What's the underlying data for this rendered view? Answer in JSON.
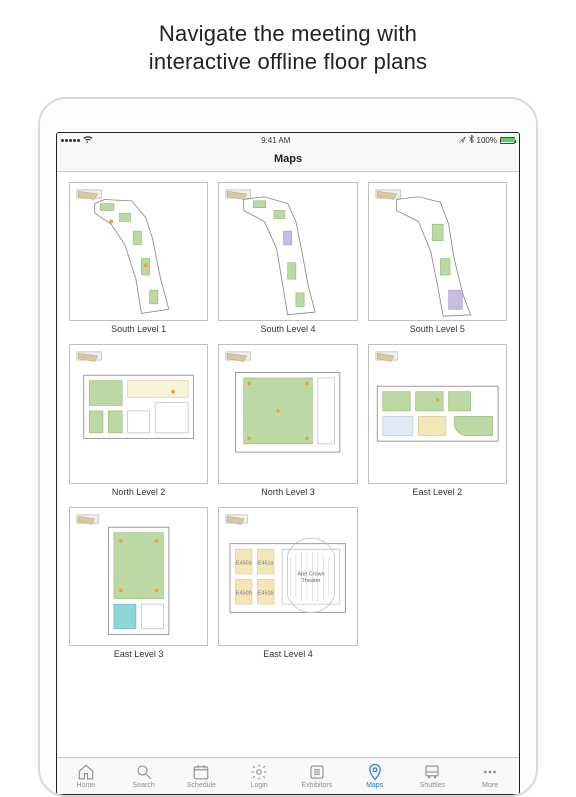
{
  "headline": {
    "line1": "Navigate the meeting with",
    "line2": "interactive offline floor plans"
  },
  "status": {
    "carrier_signal": "•••••",
    "wifi": "wifi",
    "time": "9:41 AM",
    "location": "nav-arrow",
    "bluetooth": "bt",
    "battery_pct": "100%"
  },
  "nav": {
    "title": "Maps"
  },
  "maps": [
    {
      "label": "South Level 1",
      "kind": "south1"
    },
    {
      "label": "South Level 4",
      "kind": "south4"
    },
    {
      "label": "South Level 5",
      "kind": "south5"
    },
    {
      "label": "North Level 2",
      "kind": "north2"
    },
    {
      "label": "North Level 3",
      "kind": "north3"
    },
    {
      "label": "East Level 2",
      "kind": "east2"
    },
    {
      "label": "East Level 3",
      "kind": "east3"
    },
    {
      "label": "East Level 4",
      "kind": "east4"
    }
  ],
  "tabs": [
    {
      "label": "Home",
      "icon": "home"
    },
    {
      "label": "Search",
      "icon": "search"
    },
    {
      "label": "Schedule",
      "icon": "calendar"
    },
    {
      "label": "Login",
      "icon": "gear"
    },
    {
      "label": "Exhibitors",
      "icon": "list"
    },
    {
      "label": "Maps",
      "icon": "pin",
      "active": true
    },
    {
      "label": "Shuttles",
      "icon": "bus"
    },
    {
      "label": "More",
      "icon": "more"
    }
  ]
}
